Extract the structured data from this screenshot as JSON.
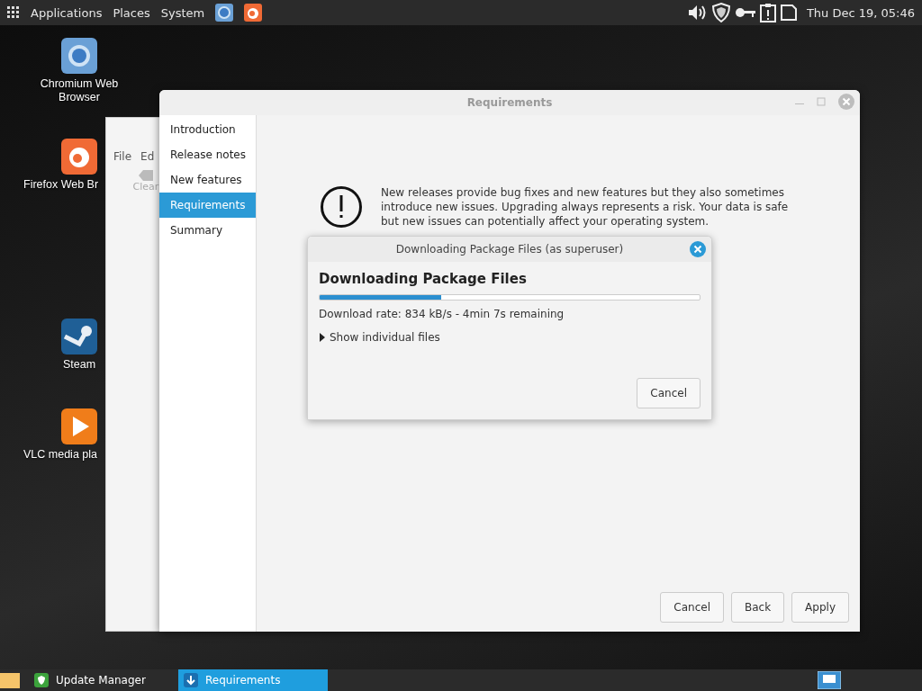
{
  "top_panel": {
    "menus": [
      "Applications",
      "Places",
      "System"
    ],
    "clock": "Thu Dec 19, 05:46"
  },
  "desktop_icons": [
    {
      "label": "Chromium Web Browser",
      "kind": "chromium"
    },
    {
      "label": "Firefox Web Br",
      "kind": "firefox"
    },
    {
      "label": "Steam",
      "kind": "steam"
    },
    {
      "label": "VLC media pla",
      "kind": "vlc"
    }
  ],
  "background_window": {
    "menus": [
      "File",
      "Ed"
    ],
    "toolbar_button": "Clear"
  },
  "window": {
    "title": "Requirements",
    "sidebar": {
      "items": [
        {
          "label": "Introduction",
          "selected": false
        },
        {
          "label": "Release notes",
          "selected": false
        },
        {
          "label": "New features",
          "selected": false
        },
        {
          "label": "Requirements",
          "selected": true
        },
        {
          "label": "Summary",
          "selected": false
        }
      ]
    },
    "warning": "New releases provide bug fixes and new features but they also sometimes introduce new issues. Upgrading always represents a risk. Your data is safe but new issues can potentially affect your operating system.",
    "buttons": [
      "Cancel",
      "Back",
      "Apply"
    ]
  },
  "dialog": {
    "title": "Downloading Package Files (as superuser)",
    "heading": "Downloading Package Files",
    "progress": {
      "level": 0.32
    },
    "status": "Download rate: 834 kB/s - 4min 7s remaining",
    "expander": {
      "label": "Show individual files",
      "expanded": false
    },
    "button": "Cancel"
  },
  "taskbar": {
    "tasks": [
      {
        "label": "Update Manager",
        "selected": false,
        "kind": "update"
      },
      {
        "label": "Requirements",
        "selected": true,
        "kind": "download"
      }
    ]
  }
}
